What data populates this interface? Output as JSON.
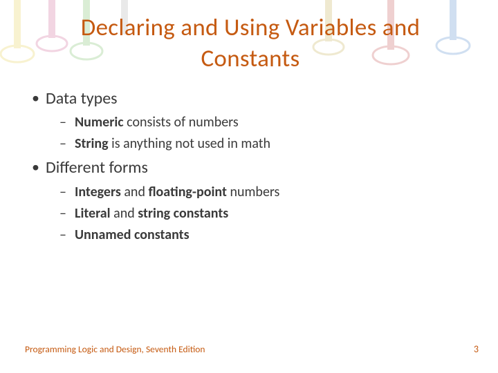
{
  "title": "Declaring and Using Variables and Constants",
  "bullets": {
    "b1": {
      "text": "Data types"
    },
    "b1s1": {
      "bold": "Numeric",
      "rest": " consists of numbers"
    },
    "b1s2": {
      "bold": "String",
      "rest": " is anything not used in math"
    },
    "b2": {
      "text": "Different forms"
    },
    "b2s1": {
      "bold1": "Integers",
      "mid": " and ",
      "bold2": "floating-point",
      "rest": " numbers"
    },
    "b2s2": {
      "bold1": "Literal",
      "mid": " and ",
      "bold2": "string constants"
    },
    "b2s3": {
      "bold": "Unnamed constants"
    }
  },
  "footer": {
    "left": "Programming Logic and Design, Seventh Edition",
    "page": "3"
  }
}
